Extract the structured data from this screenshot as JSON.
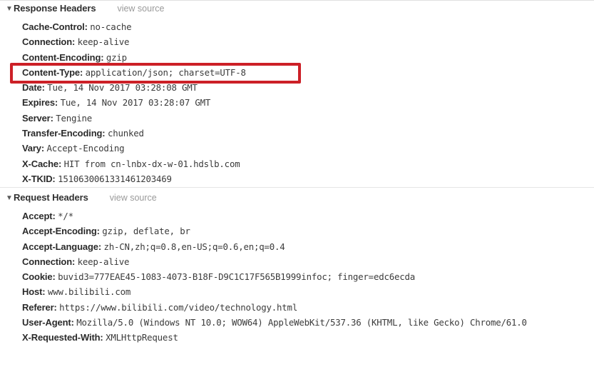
{
  "panel": {
    "name": "network-headers-panel",
    "disclosure_glyph": "▼",
    "view_source_label": "view source",
    "highlight_color": "#cc2027"
  },
  "response_headers": {
    "title": "Response Headers",
    "view_source_label": "view source",
    "rows": [
      {
        "name": "Cache-Control:",
        "value": "no-cache"
      },
      {
        "name": "Connection:",
        "value": "keep-alive"
      },
      {
        "name": "Content-Encoding:",
        "value": "gzip"
      },
      {
        "name": "Content-Type:",
        "value": "application/json; charset=UTF-8"
      },
      {
        "name": "Date:",
        "value": "Tue, 14 Nov 2017 03:28:08 GMT"
      },
      {
        "name": "Expires:",
        "value": "Tue, 14 Nov 2017 03:28:07 GMT"
      },
      {
        "name": "Server:",
        "value": "Tengine"
      },
      {
        "name": "Transfer-Encoding:",
        "value": "chunked"
      },
      {
        "name": "Vary:",
        "value": "Accept-Encoding"
      },
      {
        "name": "X-Cache:",
        "value": "HIT from cn-lnbx-dx-w-01.hdslb.com"
      },
      {
        "name": "X-TKID:",
        "value": "1510630061331461203469"
      }
    ]
  },
  "request_headers": {
    "title": "Request Headers",
    "view_source_label": "view source",
    "rows": [
      {
        "name": "Accept:",
        "value": "*/*"
      },
      {
        "name": "Accept-Encoding:",
        "value": "gzip, deflate, br"
      },
      {
        "name": "Accept-Language:",
        "value": "zh-CN,zh;q=0.8,en-US;q=0.6,en;q=0.4"
      },
      {
        "name": "Connection:",
        "value": "keep-alive"
      },
      {
        "name": "Cookie:",
        "value": "buvid3=777EAE45-1083-4073-B18F-D9C1C17F565B1999infoc; finger=edc6ecda"
      },
      {
        "name": "Host:",
        "value": "www.bilibili.com"
      },
      {
        "name": "Referer:",
        "value": "https://www.bilibili.com/video/technology.html"
      },
      {
        "name": "User-Agent:",
        "value": "Mozilla/5.0 (Windows NT 10.0; WOW64) AppleWebKit/537.36 (KHTML, like Gecko) Chrome/61.0"
      },
      {
        "name": "X-Requested-With:",
        "value": "XMLHttpRequest"
      }
    ]
  }
}
